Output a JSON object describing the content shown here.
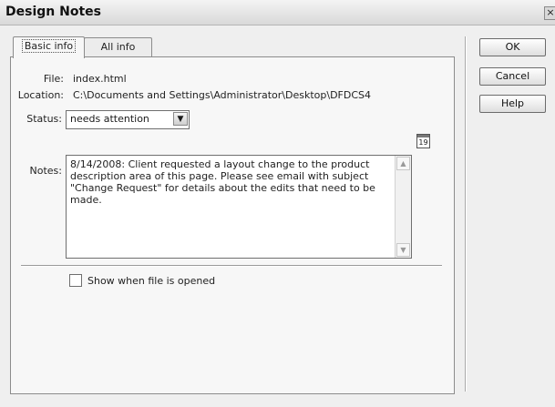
{
  "window": {
    "title": "Design Notes",
    "close_glyph": "×"
  },
  "tabs": [
    {
      "label": "Basic info",
      "active": true
    },
    {
      "label": "All info",
      "active": false
    }
  ],
  "form": {
    "file_label": "File:",
    "file_value": "index.html",
    "location_label": "Location:",
    "location_value": "C:\\Documents and Settings\\Administrator\\Desktop\\DFDCS4",
    "status_label": "Status:",
    "status_value": "needs attention",
    "calendar_day": "19",
    "notes_label": "Notes:",
    "notes_value": "8/14/2008: Client requested a layout change to the product\ndescription area of this page. Please see email with subject\n\"Change Request\" for details about the edits that need to be\nmade.",
    "show_when_opened_label": "Show when file is opened",
    "show_when_opened_checked": false
  },
  "buttons": {
    "ok": "OK",
    "cancel": "Cancel",
    "help": "Help"
  },
  "icons": {
    "close": "close-icon",
    "dropdown": "chevron-down-icon",
    "calendar": "calendar-icon",
    "scroll_up": "scroll-up-icon",
    "scroll_down": "scroll-down-icon"
  }
}
